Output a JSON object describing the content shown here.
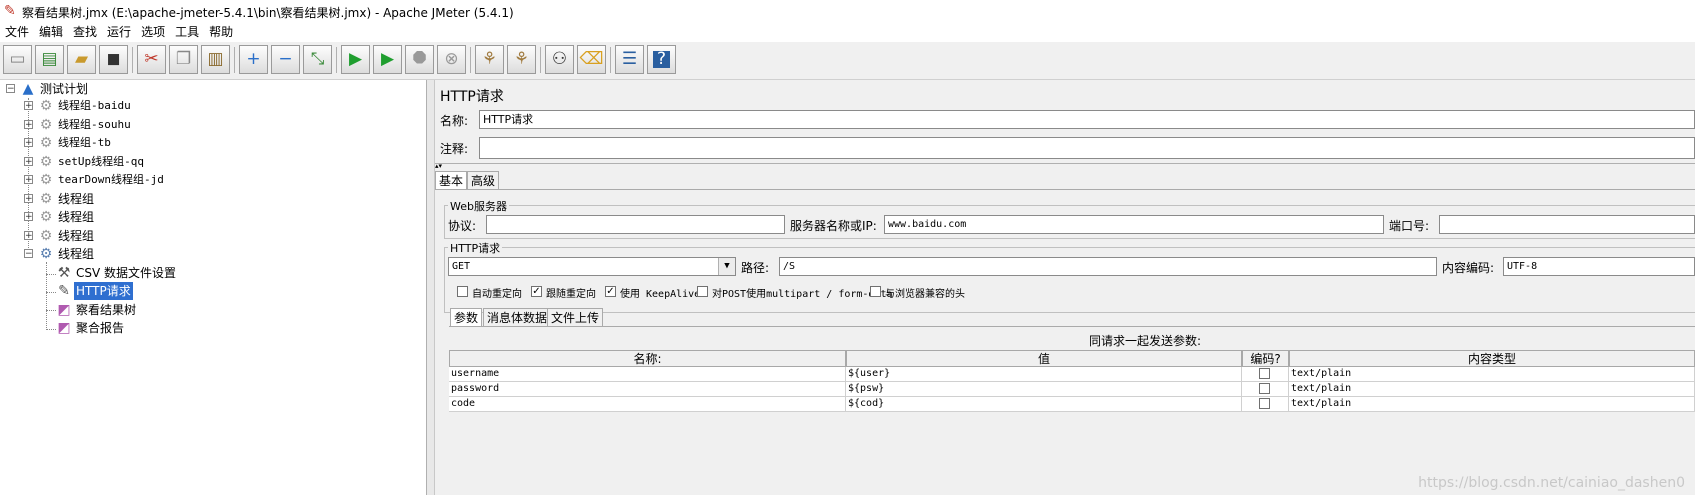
{
  "window": {
    "title": "察看结果树.jmx (E:\\apache-jmeter-5.4.1\\bin\\察看结果树.jmx) - Apache JMeter (5.4.1)"
  },
  "menu": [
    "文件",
    "编辑",
    "查找",
    "运行",
    "选项",
    "工具",
    "帮助"
  ],
  "tree": {
    "root": "测试计划",
    "thread_groups": [
      "线程组-baidu",
      "线程组-souhu",
      "线程组-tb",
      "setUp线程组-qq",
      "tearDown线程组-jd",
      "线程组",
      "线程组",
      "线程组"
    ],
    "expanded_group": "线程组",
    "children": [
      "CSV 数据文件设置",
      "HTTP请求",
      "察看结果树",
      "聚合报告"
    ]
  },
  "http": {
    "panel_title": "HTTP请求",
    "name_label": "名称:",
    "name_value": "HTTP请求",
    "comment_label": "注释:",
    "comment_value": "",
    "tabs": [
      "基本",
      "高级"
    ],
    "web_server": {
      "legend": "Web服务器",
      "protocol_label": "协议:",
      "protocol_value": "",
      "server_label": "服务器名称或IP:",
      "server_value": "www.baidu.com",
      "port_label": "端口号:",
      "port_value": ""
    },
    "request": {
      "legend": "HTTP请求",
      "method": "GET",
      "path_label": "路径:",
      "path_value": "/S",
      "encoding_label": "内容编码:",
      "encoding_value": "UTF-8"
    },
    "options": [
      {
        "label": "自动重定向",
        "checked": false
      },
      {
        "label": "跟随重定向",
        "checked": true
      },
      {
        "label": "使用 KeepAlive",
        "checked": true
      },
      {
        "label": "对POST使用multipart / form-data",
        "checked": false
      },
      {
        "label": "与浏览器兼容的头",
        "checked": false
      }
    ],
    "param_tabs": [
      "参数",
      "消息体数据",
      "文件上传"
    ],
    "params_caption": "同请求一起发送参数:",
    "columns": [
      "名称:",
      "值",
      "编码?",
      "内容类型"
    ],
    "params": [
      {
        "name": "username",
        "value": "${user}",
        "encode": false,
        "type": "text/plain"
      },
      {
        "name": "password",
        "value": "${psw}",
        "encode": false,
        "type": "text/plain"
      },
      {
        "name": "code",
        "value": "${cod}",
        "encode": false,
        "type": "text/plain"
      }
    ]
  },
  "watermark": "https://blog.csdn.net/cainiao_dashen0"
}
